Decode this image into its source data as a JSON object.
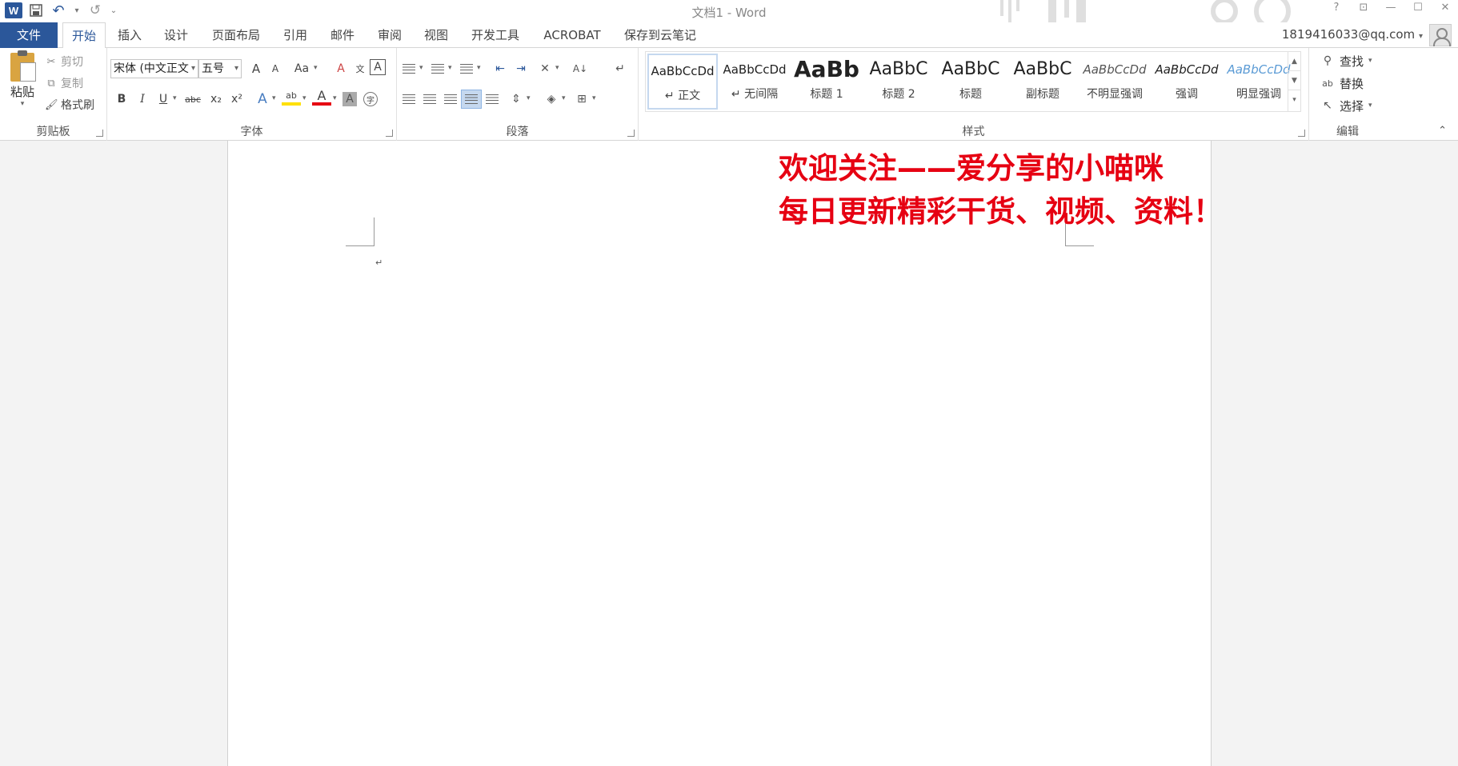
{
  "window": {
    "title": "文档1 - Word"
  },
  "qat": {
    "app_icon": "W",
    "redo_symbol": "↺",
    "undo_symbol": "↶",
    "more_symbol": "⌄"
  },
  "window_controls": {
    "help": "?",
    "ribbon_options": "⊡",
    "minimize": "—",
    "maximize": "☐",
    "close": "✕"
  },
  "tabs": {
    "file": "文件",
    "home": "开始",
    "insert": "插入",
    "design": "设计",
    "layout": "页面布局",
    "references": "引用",
    "mailings": "邮件",
    "review": "审阅",
    "view": "视图",
    "developer": "开发工具",
    "acrobat": "ACROBAT",
    "evernote": "保存到云笔记"
  },
  "account": {
    "email": "1819416033@qq.com"
  },
  "clipboard": {
    "paste": "粘贴",
    "cut": "剪切",
    "copy": "复制",
    "format_painter": "格式刷",
    "label": "剪贴板"
  },
  "font": {
    "name": "宋体 (中文正文",
    "size": "五号",
    "grow": "A",
    "shrink": "A",
    "change_case": "Aa",
    "clear": "A",
    "phonetic": "文",
    "char_border": "A",
    "bold": "B",
    "italic": "I",
    "underline": "U",
    "strike": "abc",
    "subscript": "x₂",
    "superscript": "x²",
    "text_effects": "A",
    "highlight": "ab",
    "font_color": "A",
    "char_shading": "A",
    "enclose": "字",
    "label": "字体"
  },
  "paragraph": {
    "label": "段落",
    "sort": "A↓",
    "show_marks": "↵"
  },
  "styles": {
    "label": "样式",
    "items": [
      {
        "sample": "AaBbCcDd",
        "name": "↵ 正文"
      },
      {
        "sample": "AaBbCcDd",
        "name": "↵ 无间隔"
      },
      {
        "sample": "AaBb",
        "name": "标题 1"
      },
      {
        "sample": "AaBbC",
        "name": "标题 2"
      },
      {
        "sample": "AaBbC",
        "name": "标题"
      },
      {
        "sample": "AaBbC",
        "name": "副标题"
      },
      {
        "sample": "AaBbCcDd",
        "name": "不明显强调"
      },
      {
        "sample": "AaBbCcDd",
        "name": "强调"
      },
      {
        "sample": "AaBbCcDd",
        "name": "明显强调"
      }
    ]
  },
  "editing": {
    "find": "查找",
    "replace": "替换",
    "select": "选择",
    "label": "编辑"
  },
  "document": {
    "paragraph_mark": "↵",
    "overlay_line1": "欢迎关注——爱分享的小喵咪",
    "overlay_line2": "每日更新精彩干货、视频、资料！"
  },
  "colors": {
    "word_blue": "#2b579a",
    "overlay_red": "#e60012",
    "highlight_yellow": "#ffe000",
    "font_red": "#e60012"
  }
}
